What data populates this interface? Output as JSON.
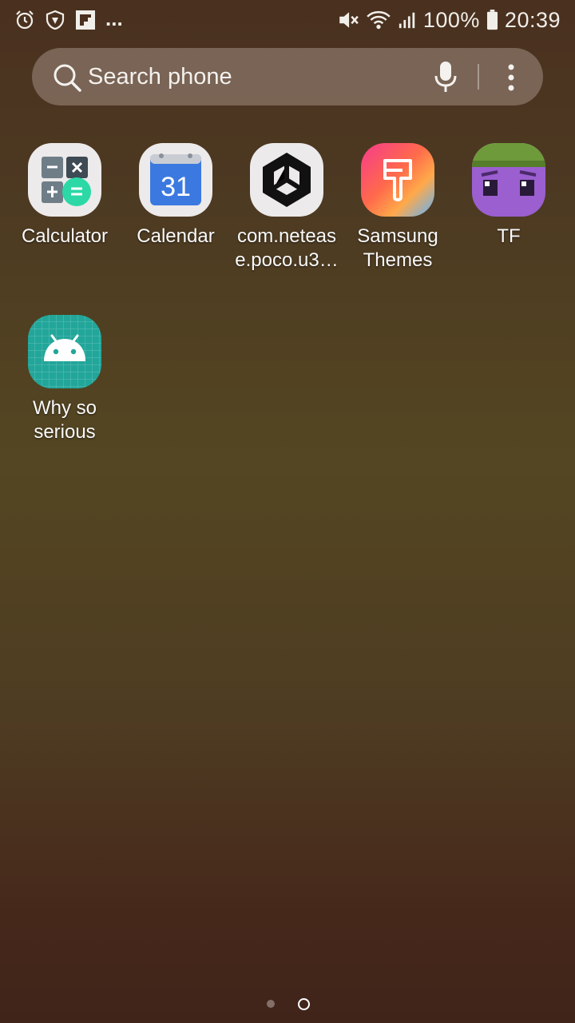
{
  "status_bar": {
    "overflow": "...",
    "battery": "100%",
    "time": "20:39",
    "icons_left": [
      "alarm-icon",
      "shield-icon",
      "flipboard-icon"
    ],
    "icons_right": [
      "mute-icon",
      "wifi-icon",
      "signal-icon",
      "battery-icon"
    ]
  },
  "search": {
    "placeholder": "Search phone"
  },
  "apps": [
    {
      "label": "Calculator",
      "icon": "calculator-icon"
    },
    {
      "label": "Calendar",
      "icon": "calendar-icon",
      "icon_text": "31"
    },
    {
      "label": "com.netease.poco.u3…",
      "line1": "com.neteas",
      "line2": "e.poco.u3…",
      "icon": "unity-icon"
    },
    {
      "label": "Samsung Themes",
      "line1": "Samsung",
      "line2": "Themes",
      "icon": "samsung-themes-icon"
    },
    {
      "label": "TF",
      "icon": "tf-game-icon"
    },
    {
      "label": "Why so serious",
      "line1": "Why so",
      "line2": "serious",
      "icon": "android-icon"
    }
  ],
  "page_indicator": {
    "pages": 2,
    "current": 2
  },
  "colors": {
    "calculator_green": "#2bd8a6",
    "calendar_blue": "#3b79e0",
    "android_teal": "#22a69a"
  }
}
